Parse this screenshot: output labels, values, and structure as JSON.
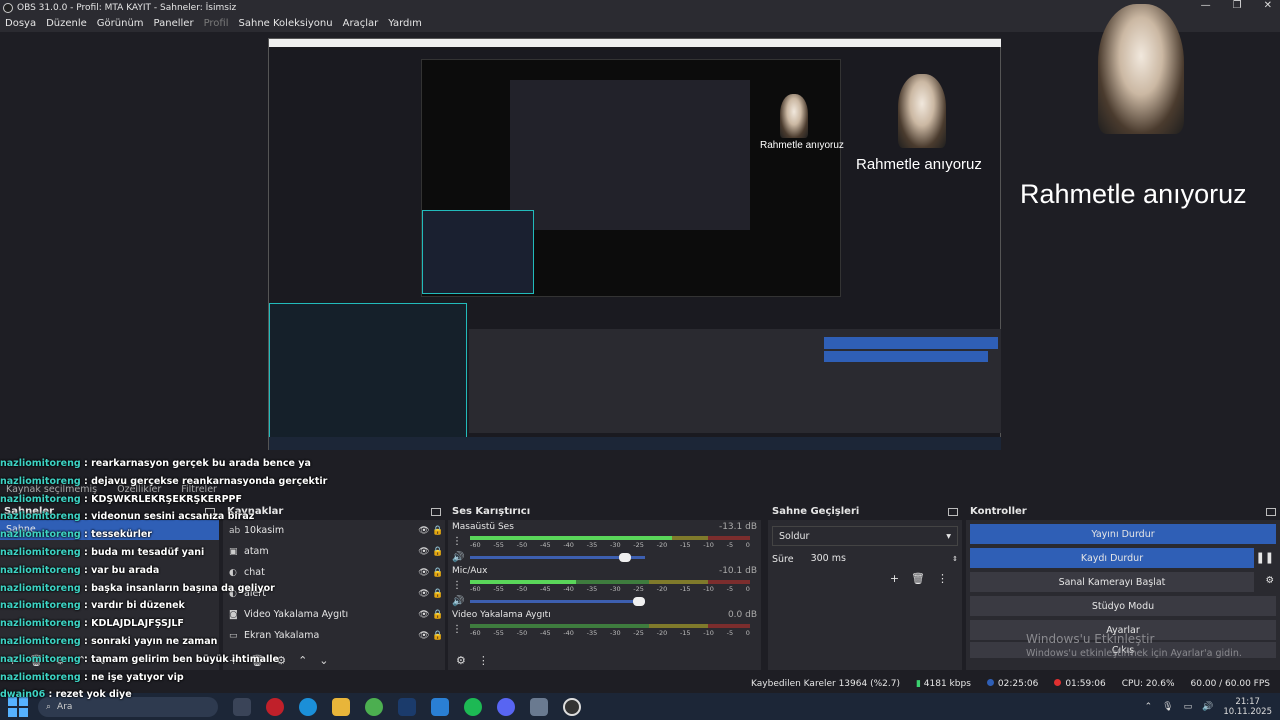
{
  "window": {
    "title": "OBS 31.0.0 - Profil: MTA KAYIT - Sahneler: İsimsiz",
    "minimize": "—",
    "maximize": "❐",
    "close": "✕"
  },
  "menu": {
    "items": [
      "Dosya",
      "Düzenle",
      "Görünüm",
      "Paneller",
      "Profil",
      "Sahne Koleksiyonu",
      "Araçlar",
      "Yardım"
    ]
  },
  "preview": {
    "memorial_text": "Rahmetle anıyoruz"
  },
  "chat": {
    "lines": [
      {
        "user": "nazliomitoreng",
        "msg": " : rearkarnasyon gerçek bu arada bence ya"
      },
      {
        "user": "nazliomitoreng",
        "msg": " : dejavu gerçekse reankarnasyonda gerçektir"
      },
      {
        "user": "nazliomitoreng",
        "msg": " : KDŞWKRLEKRŞEKRŞKERPPF"
      },
      {
        "user": "nazliomitoreng",
        "msg": " : videonun sesini acsanıza biraz"
      },
      {
        "user": "nazliomitoreng",
        "msg": " : tessekürler"
      },
      {
        "user": "nazliomitoreng",
        "msg": " : buda mı tesadüf yani"
      },
      {
        "user": "nazliomitoreng",
        "msg": " : var bu arada"
      },
      {
        "user": "nazliomitoreng",
        "msg": " : başka insanların başına da geliyor"
      },
      {
        "user": "nazliomitoreng",
        "msg": " : vardır bi düzenek"
      },
      {
        "user": "nazliomitoreng",
        "msg": " : KDLAJDLAJFŞSJLF"
      },
      {
        "user": "nazliomitoreng",
        "msg": " : sonraki yayın ne zaman"
      },
      {
        "user": "nazliomitoreng",
        "msg": " : tamam gelirim ben büyük ihtimalle"
      },
      {
        "user": "nazliomitoreng",
        "msg": " : ne işe yatıyor vip"
      }
    ],
    "footer_user": "dwain06",
    "footer_msg": " : rezet yok diye"
  },
  "source_info": {
    "no_source": "Kaynak seçilmemiş",
    "properties": "Özellikler",
    "filters": "Filtreler"
  },
  "scenes": {
    "title": "Sahneler",
    "items": [
      "Sahne"
    ]
  },
  "sources": {
    "title": "Kaynaklar",
    "items": [
      {
        "icon": "ab",
        "name": "10kasim"
      },
      {
        "icon": "▣",
        "name": "atam"
      },
      {
        "icon": "◐",
        "name": "chat"
      },
      {
        "icon": "◐",
        "name": "alert"
      },
      {
        "icon": "◙",
        "name": "Video Yakalama Aygıtı"
      },
      {
        "icon": "▭",
        "name": "Ekran Yakalama"
      }
    ]
  },
  "mixer": {
    "title": "Ses Karıştırıcı",
    "ticks": [
      "-60",
      "-55",
      "-50",
      "-45",
      "-40",
      "-35",
      "-30",
      "-25",
      "-20",
      "-15",
      "-10",
      "-5",
      "0"
    ],
    "channels": [
      {
        "name": "Masaüstü Ses",
        "db": "-13.1 dB",
        "level": 0.72,
        "volume": 0.92
      },
      {
        "name": "Mic/Aux",
        "db": "-10.1 dB",
        "level": 0.38,
        "volume": 1.0
      },
      {
        "name": "Video Yakalama Aygıtı",
        "db": "0.0 dB",
        "level": 0.0,
        "volume": 1.0
      }
    ]
  },
  "transitions": {
    "title": "Sahne Geçişleri",
    "selected": "Soldur",
    "duration_label": "Süre",
    "duration_value": "300 ms"
  },
  "controls": {
    "title": "Kontroller",
    "stop_stream": "Yayını Durdur",
    "stop_record": "Kaydı Durdur",
    "virtual_cam": "Sanal Kamerayı Başlat",
    "studio_mode": "Stüdyo Modu",
    "settings": "Ayarlar",
    "exit": "Çıkış"
  },
  "watermark": {
    "line1": "Windows'u Etkinleştir",
    "line2": "Windows'u etkinleştirmek için Ayarlar'a gidin."
  },
  "status": {
    "dropped": "Kaybedilen Kareler 13964 (%2.7)",
    "bitrate": "4181 kbps",
    "stream_time": "02:25:06",
    "rec_time": "01:59:06",
    "cpu": "CPU: 20.6%",
    "fps": "60.00 / 60.00 FPS"
  },
  "taskbar": {
    "search": "Ara",
    "time": "21:17",
    "date": "10.11.2025"
  },
  "colors": {
    "accent": "#2f5fb6",
    "chat_user": "#3dd3c4",
    "stream_green": "#3bd16f",
    "rec_red": "#e03030"
  }
}
